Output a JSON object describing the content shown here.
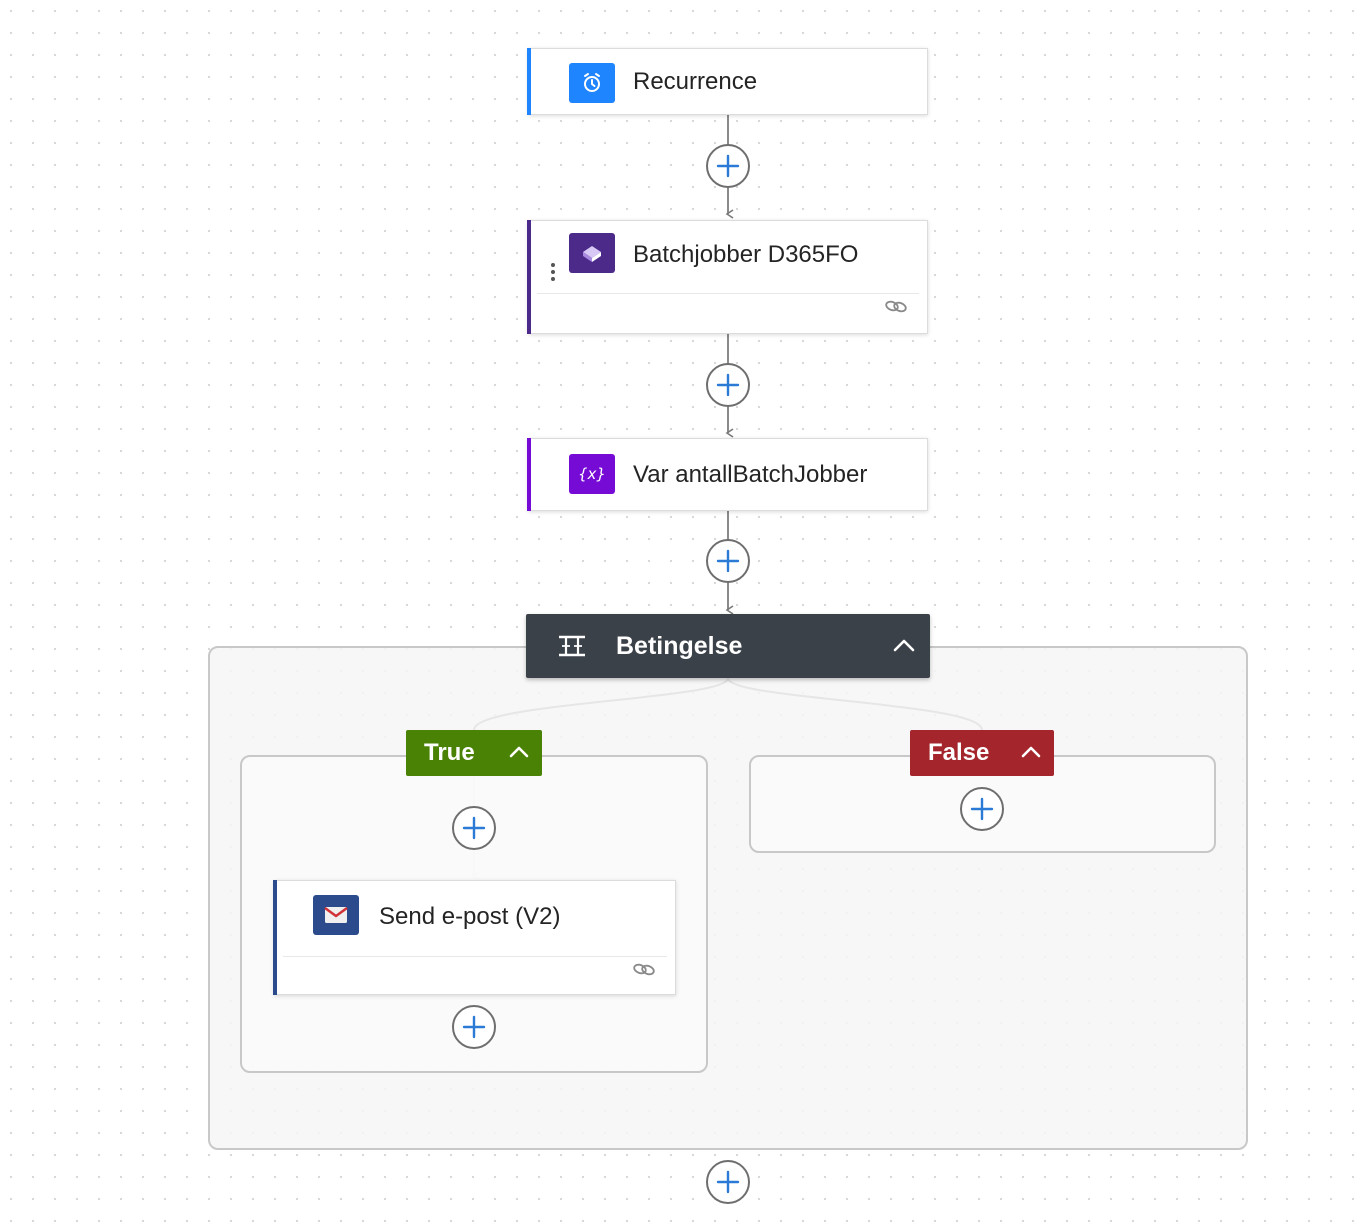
{
  "flow": {
    "trigger": {
      "title": "Recurrence",
      "icon": "alarm-clock-icon",
      "accent": "#1f85ff"
    },
    "steps": [
      {
        "title": "Batchjobber D365FO",
        "icon": "d365-finance-operations-icon",
        "accent": "#4b2a8a",
        "has_link_icon": true
      },
      {
        "title": "Var antallBatchJobber",
        "icon": "variable-icon",
        "accent": "#770bd6"
      }
    ],
    "condition": {
      "title": "Betingelse",
      "icon": "condition-icon",
      "header_color": "#3b4148",
      "true_branch": {
        "label": "True",
        "color": "#498205",
        "actions": [
          {
            "title": "Send e-post (V2)",
            "icon": "outlook-mail-icon",
            "accent": "#2c4b8c",
            "has_link_icon": true
          }
        ]
      },
      "false_branch": {
        "label": "False",
        "color": "#a4262c",
        "actions": []
      }
    }
  }
}
